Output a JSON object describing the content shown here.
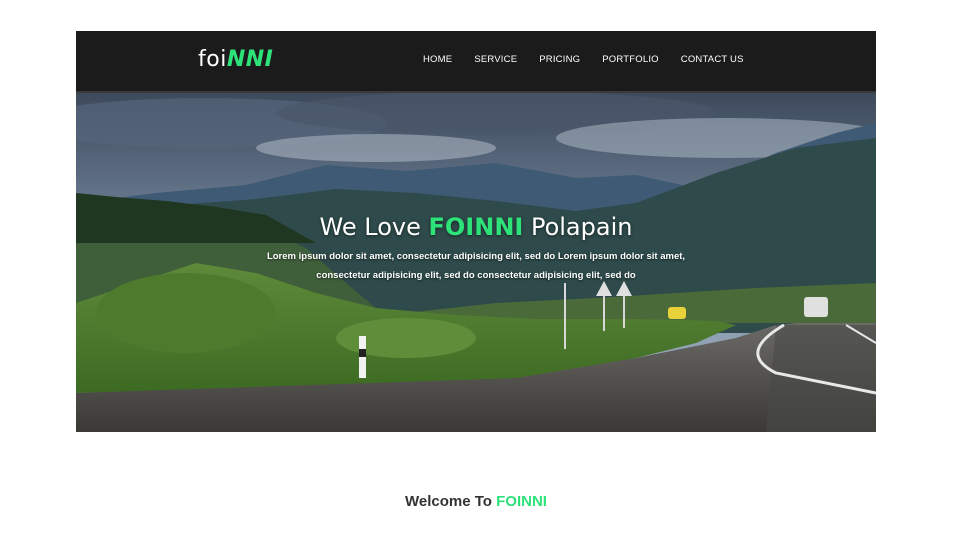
{
  "header": {
    "logo_prefix": "foi",
    "logo_accent": "NNI"
  },
  "nav": {
    "items": [
      {
        "label": "HOME"
      },
      {
        "label": "SERVICE"
      },
      {
        "label": "PRICING"
      },
      {
        "label": "PORTFOLIO"
      },
      {
        "label": "CONTACT US"
      }
    ]
  },
  "hero": {
    "title_prefix": "We Love ",
    "title_brand": "FOINNI",
    "title_suffix": " Polapain",
    "description": "Lorem ipsum dolor sit amet, consectetur adipisicing elit, sed do Lorem ipsum dolor sit amet, consectetur adipisicing elit, sed do consectetur adipisicing elit, sed do"
  },
  "welcome": {
    "prefix": "Welcome To ",
    "brand": "FOINNI"
  },
  "colors": {
    "accent": "#2ee27a",
    "navbar_bg": "#1b1b1b"
  }
}
